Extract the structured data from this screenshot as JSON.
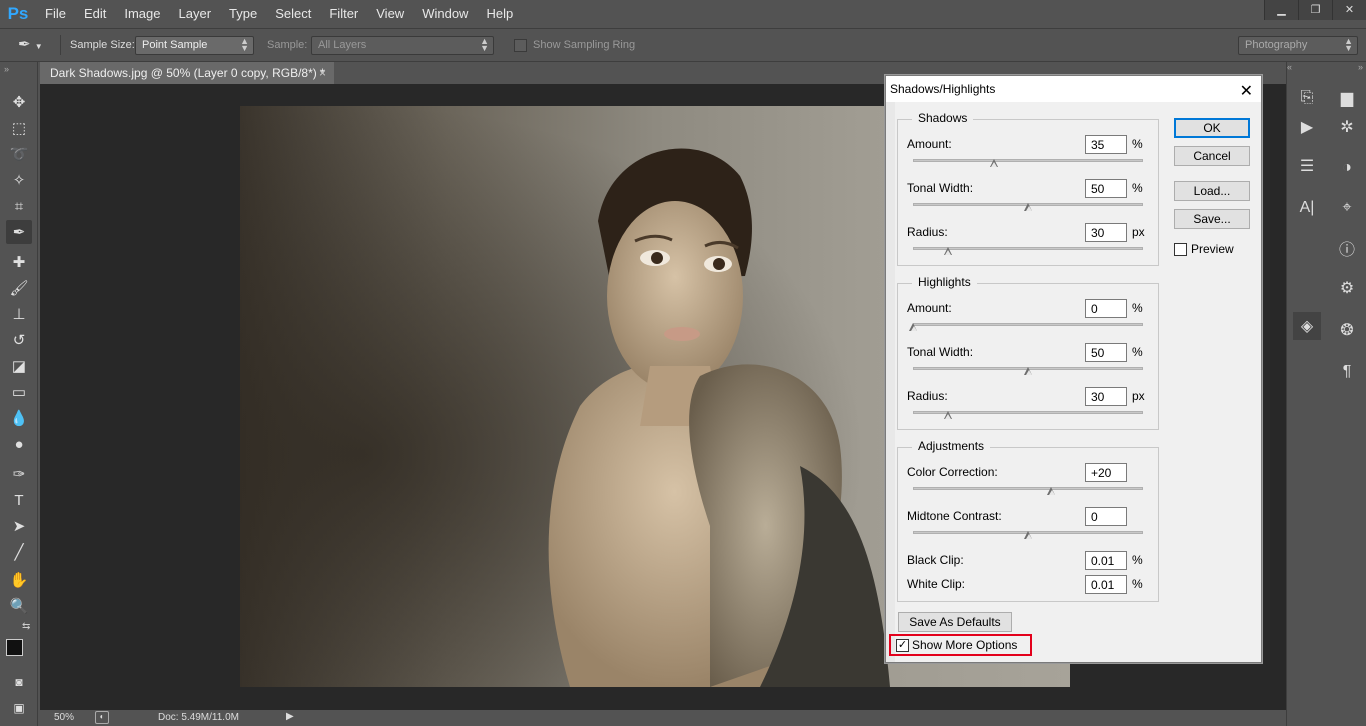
{
  "app": {
    "logo": "Ps"
  },
  "menu": [
    "File",
    "Edit",
    "Image",
    "Layer",
    "Type",
    "Select",
    "Filter",
    "View",
    "Window",
    "Help"
  ],
  "window_controls": {
    "minimize": "▁",
    "restore": "❐",
    "close": "✕"
  },
  "options_bar": {
    "sample_size_label": "Sample Size:",
    "sample_size_value": "Point Sample",
    "sample_label": "Sample:",
    "sample_value": "All Layers",
    "show_sampling_ring": "Show Sampling Ring",
    "workspace": "Photography"
  },
  "document": {
    "tab_title": "Dark Shadows.jpg @ 50% (Layer 0 copy, RGB/8*) *",
    "tab_close": "×"
  },
  "status": {
    "zoom": "50%",
    "doc_info": "Doc: 5.49M/11.0M"
  },
  "dialog": {
    "title": "Shadows/Highlights",
    "close": "✕",
    "shadows": {
      "title": "Shadows",
      "amount_label": "Amount:",
      "amount": "35",
      "amount_unit": "%",
      "amount_pos": 0.35,
      "tonal_label": "Tonal Width:",
      "tonal": "50",
      "tonal_unit": "%",
      "tonal_pos": 0.5,
      "radius_label": "Radius:",
      "radius": "30",
      "radius_unit": "px",
      "radius_pos": 0.15
    },
    "highlights": {
      "title": "Highlights",
      "amount_label": "Amount:",
      "amount": "0",
      "amount_unit": "%",
      "amount_pos": 0.0,
      "tonal_label": "Tonal Width:",
      "tonal": "50",
      "tonal_unit": "%",
      "tonal_pos": 0.5,
      "radius_label": "Radius:",
      "radius": "30",
      "radius_unit": "px",
      "radius_pos": 0.15
    },
    "adjustments": {
      "title": "Adjustments",
      "color_label": "Color Correction:",
      "color": "+20",
      "color_pos": 0.6,
      "midtone_label": "Midtone Contrast:",
      "midtone": "0",
      "midtone_pos": 0.5,
      "black_label": "Black Clip:",
      "black": "0.01",
      "black_unit": "%",
      "white_label": "White Clip:",
      "white": "0.01",
      "white_unit": "%"
    },
    "save_defaults": "Save As Defaults",
    "show_more": "Show More Options",
    "show_more_checked": "✓",
    "buttons": {
      "ok": "OK",
      "cancel": "Cancel",
      "load": "Load...",
      "save": "Save..."
    },
    "preview": "Preview"
  }
}
